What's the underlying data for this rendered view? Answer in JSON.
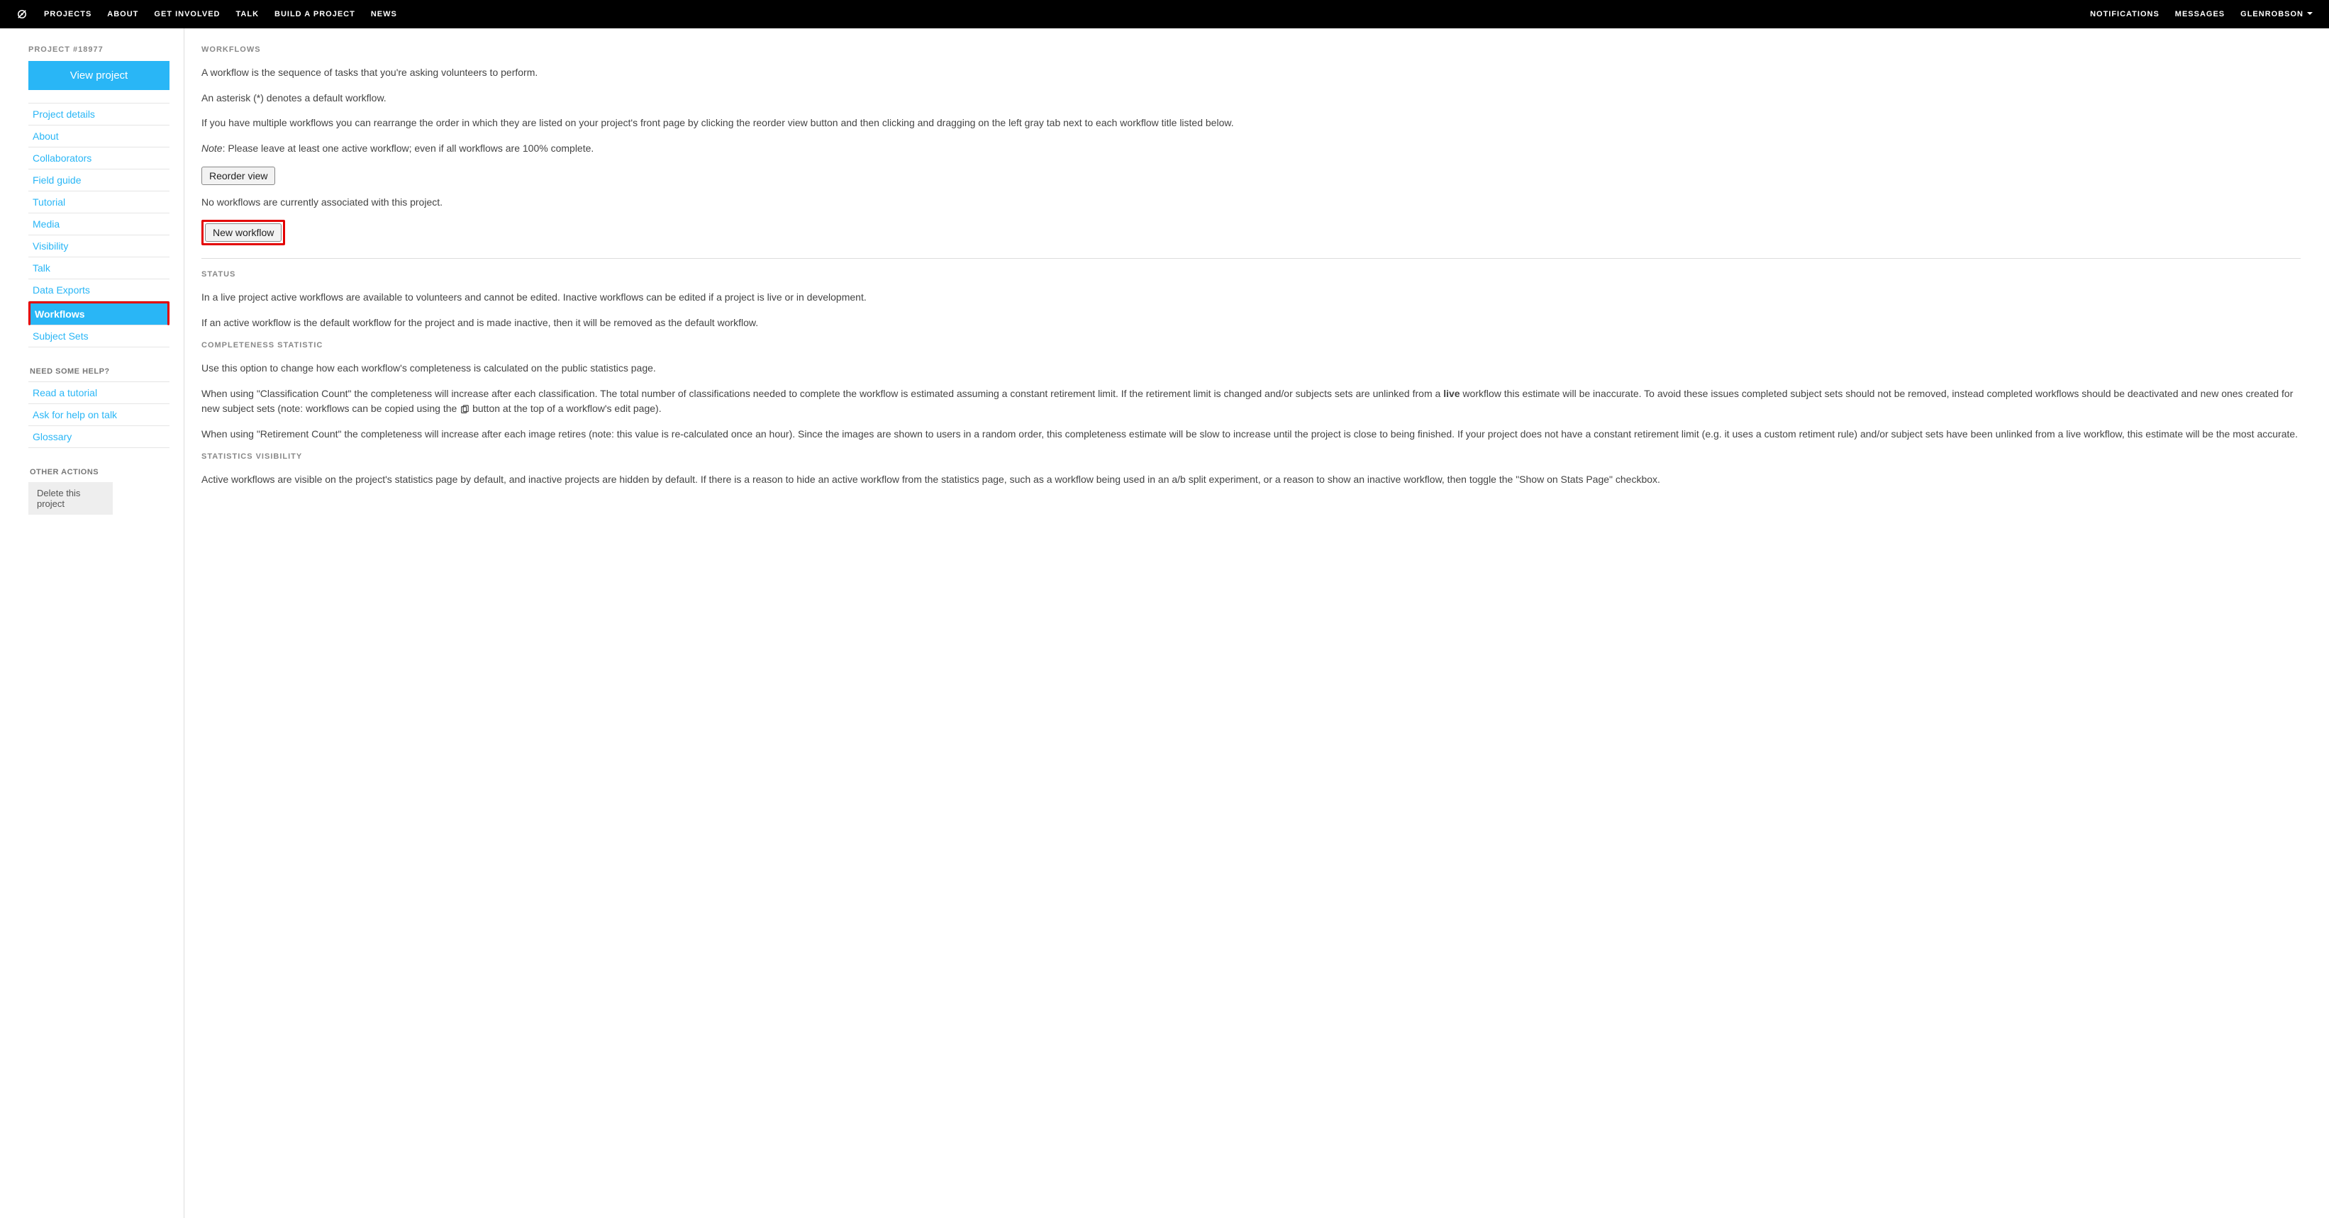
{
  "navbar": {
    "left": [
      "PROJECTS",
      "ABOUT",
      "GET INVOLVED",
      "TALK",
      "BUILD A PROJECT",
      "NEWS"
    ],
    "right": [
      "NOTIFICATIONS",
      "MESSAGES"
    ],
    "user": "GLENROBSON"
  },
  "sidebar": {
    "project_label": "PROJECT #18977",
    "view_project": "View project",
    "items": [
      "Project details",
      "About",
      "Collaborators",
      "Field guide",
      "Tutorial",
      "Media",
      "Visibility",
      "Talk",
      "Data Exports",
      "Workflows",
      "Subject Sets"
    ],
    "active_index": 9,
    "help_label": "NEED SOME HELP?",
    "help_items": [
      "Read a tutorial",
      "Ask for help on talk",
      "Glossary"
    ],
    "other_label": "OTHER ACTIONS",
    "delete_label": "Delete this project"
  },
  "main": {
    "workflows": {
      "heading": "WORKFLOWS",
      "intro": "A workflow is the sequence of tasks that you're asking volunteers to perform.",
      "asterisk": "An asterisk (*) denotes a default workflow.",
      "multi": "If you have multiple workflows you can rearrange the order in which they are listed on your project's front page by clicking the reorder view button and then clicking and dragging on the left gray tab next to each workflow title listed below.",
      "note_label": "Note",
      "note": ": Please leave at least one active workflow; even if all workflows are 100% complete.",
      "reorder_btn": "Reorder view",
      "none": "No workflows are currently associated with this project.",
      "new_btn": "New workflow"
    },
    "status": {
      "heading": "STATUS",
      "p1": "In a live project active workflows are available to volunteers and cannot be edited. Inactive workflows can be edited if a project is live or in development.",
      "p2": "If an active workflow is the default workflow for the project and is made inactive, then it will be removed as the default workflow."
    },
    "completeness": {
      "heading": "COMPLETENESS STATISTIC",
      "p1": "Use this option to change how each workflow's completeness is calculated on the public statistics page.",
      "p2a": "When using \"Classification Count\" the completeness will increase after each classification. The total number of classifications needed to complete the workflow is estimated assuming a constant retirement limit. If the retirement limit is changed and/or subjects sets are unlinked from a ",
      "p2b_bold": "live",
      "p2c": " workflow this estimate will be inaccurate. To avoid these issues completed subject sets should not be removed, instead completed workflows should be deactivated and new ones created for new subject sets (note: workflows can be copied using the ",
      "p2d": " button at the top of a workflow's edit page).",
      "p3": "When using \"Retirement Count\" the completeness will increase after each image retires (note: this value is re-calculated once an hour). Since the images are shown to users in a random order, this completeness estimate will be slow to increase until the project is close to being finished. If your project does not have a constant retirement limit (e.g. it uses a custom retiment rule) and/or subject sets have been unlinked from a live workflow, this estimate will be the most accurate."
    },
    "stats_vis": {
      "heading": "STATISTICS VISIBILITY",
      "p1": "Active workflows are visible on the project's statistics page by default, and inactive projects are hidden by default. If there is a reason to hide an active workflow from the statistics page, such as a workflow being used in an a/b split experiment, or a reason to show an inactive workflow, then toggle the \"Show on Stats Page\" checkbox."
    }
  }
}
